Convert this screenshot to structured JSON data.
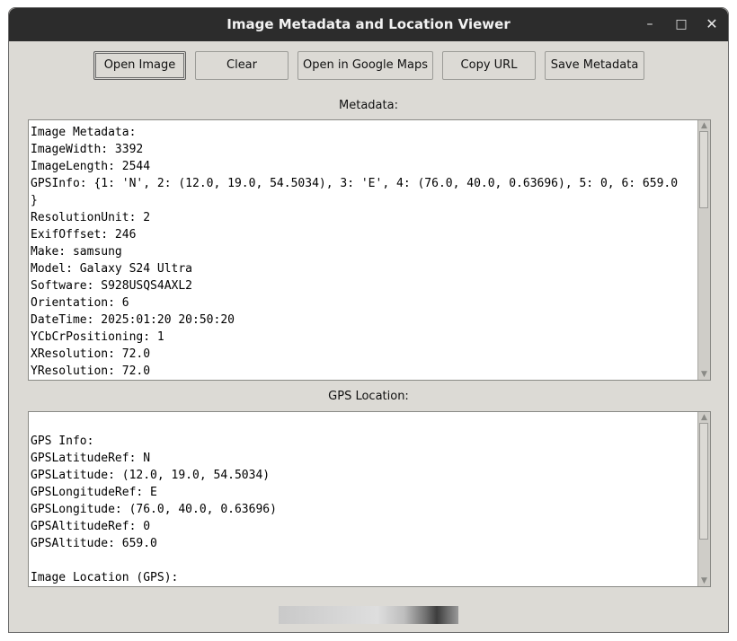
{
  "window": {
    "title": "Image Metadata and Location Viewer",
    "controls": {
      "minimize": "–",
      "maximize": "□",
      "close": "✕"
    }
  },
  "toolbar": {
    "open_label": "Open Image",
    "clear_label": "Clear",
    "maps_label": "Open in Google Maps",
    "copy_label": "Copy URL",
    "save_label": "Save Metadata"
  },
  "metadata": {
    "label": "Metadata:",
    "lines": [
      "Image Metadata:",
      "ImageWidth: 3392",
      "ImageLength: 2544",
      "GPSInfo: {1: 'N', 2: (12.0, 19.0, 54.5034), 3: 'E', 4: (76.0, 40.0, 0.63696), 5: 0, 6: 659.0",
      "}",
      "ResolutionUnit: 2",
      "ExifOffset: 246",
      "Make: samsung",
      "Model: Galaxy S24 Ultra",
      "Software: S928USQS4AXL2",
      "Orientation: 6",
      "DateTime: 2025:01:20 20:50:20",
      "YCbCrPositioning: 1",
      "XResolution: 72.0",
      "YResolution: 72.0"
    ]
  },
  "gps": {
    "label": "GPS Location:",
    "lines": [
      "",
      "GPS Info:",
      "GPSLatitudeRef: N",
      "GPSLatitude: (12.0, 19.0, 54.5034)",
      "GPSLongitudeRef: E",
      "GPSLongitude: (76.0, 40.0, 0.63696)",
      "GPSAltitudeRef: 0",
      "GPSAltitude: 659.0",
      "",
      "Image Location (GPS):"
    ]
  },
  "scroll_arrows": {
    "up": "▲",
    "down": "▼"
  }
}
